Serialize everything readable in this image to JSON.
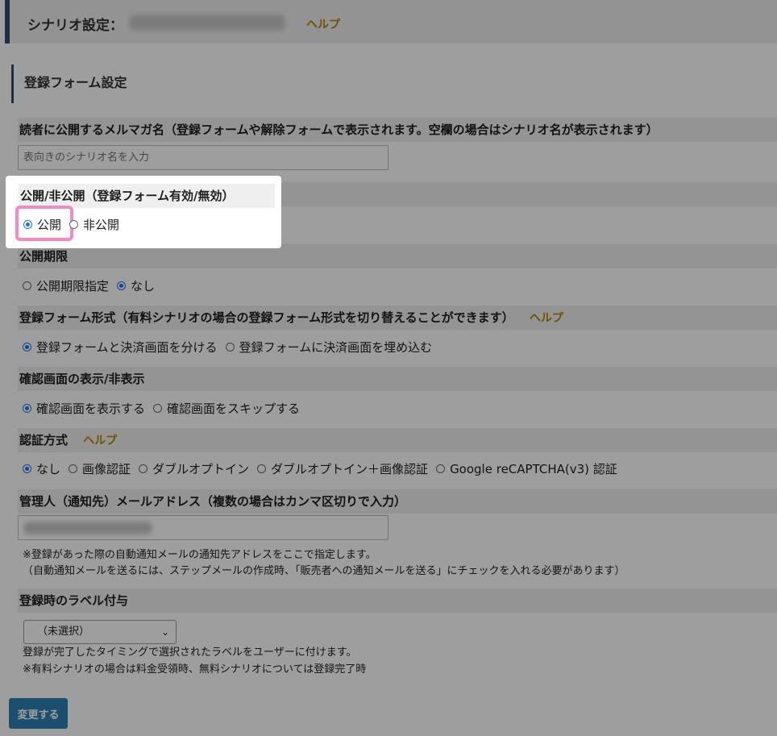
{
  "header": {
    "title": "シナリオ設定：",
    "help": "ヘルプ"
  },
  "section": {
    "title": "登録フォーム設定"
  },
  "public_name": {
    "label": "読者に公開するメルマガ名（登録フォームや解除フォームで表示されます。空欄の場合はシナリオ名が表示されます）",
    "placeholder": "表向きのシナリオ名を入力"
  },
  "visibility": {
    "label": "公開/非公開（登録フォーム有効/無効）",
    "options": [
      "公開",
      "非公開"
    ],
    "selected": "公開"
  },
  "period": {
    "label": "公開期限",
    "options": [
      "公開期限指定",
      "なし"
    ],
    "selected": "なし"
  },
  "form_type": {
    "label": "登録フォーム形式（有料シナリオの場合の登録フォーム形式を切り替えることができます）",
    "help": "ヘルプ",
    "options": [
      "登録フォームと決済画面を分ける",
      "登録フォームに決済画面を埋め込む"
    ],
    "selected": "登録フォームと決済画面を分ける"
  },
  "confirm": {
    "label": "確認画面の表示/非表示",
    "options": [
      "確認画面を表示する",
      "確認画面をスキップする"
    ],
    "selected": "確認画面を表示する"
  },
  "auth": {
    "label": "認証方式",
    "help": "ヘルプ",
    "options": [
      "なし",
      "画像認証",
      "ダブルオプトイン",
      "ダブルオプトイン＋画像認証",
      "Google reCAPTCHA(v3) 認証"
    ],
    "selected": "なし"
  },
  "admin_email": {
    "label": "管理人（通知先）メールアドレス（複数の場合はカンマ区切りで入力）",
    "note1": "※登録があった際の自動通知メールの通知先アドレスをここで指定します。",
    "note2": "（自動通知メールを送るには、ステップメールの作成時、「販売者への通知メールを送る」にチェックを入れる必要があります）"
  },
  "label_assign": {
    "label": "登録時のラベル付与",
    "select_value": "（未選択）",
    "note1": "登録が完了したタイミングで選択されたラベルをユーザーに付けます。",
    "note2": "※有料シナリオの場合は料金受領時、無料シナリオについては登録完了時"
  },
  "submit_label": "変更する",
  "colors": {
    "accent": "#1a73e8",
    "highlight": "#f28bc2",
    "submit": "#2e7fb0",
    "help": "#b08600"
  }
}
